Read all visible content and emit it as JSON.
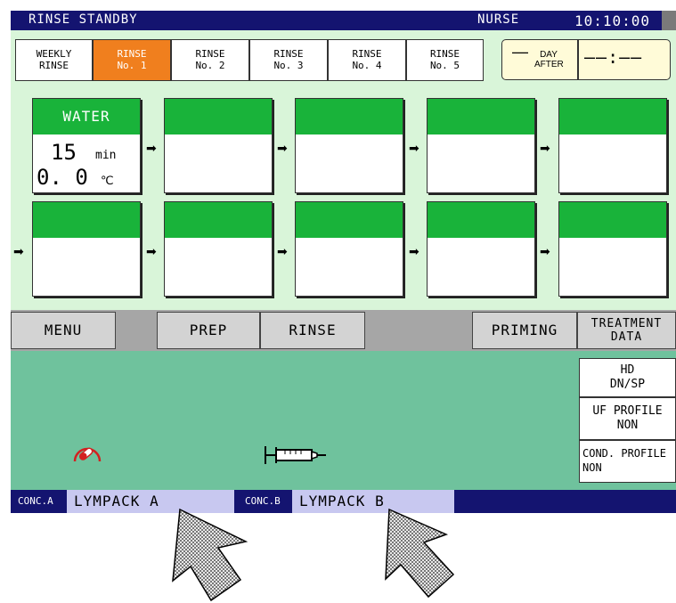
{
  "header": {
    "status": "RINSE STANDBY",
    "role": "NURSE",
    "time": "10:10:00"
  },
  "program_tabs": [
    {
      "line1": "WEEKLY",
      "line2": "RINSE"
    },
    {
      "line1": "RINSE",
      "line2": "No. 1"
    },
    {
      "line1": "RINSE",
      "line2": "No. 2"
    },
    {
      "line1": "RINSE",
      "line2": "No. 3"
    },
    {
      "line1": "RINSE",
      "line2": "No. 4"
    },
    {
      "line1": "RINSE",
      "line2": "No. 5"
    }
  ],
  "active_tab_index": 1,
  "day_after": {
    "dash": "—",
    "line1": "DAY",
    "line2": "AFTER",
    "time": "——:——"
  },
  "steps": {
    "first": {
      "title": "WATER",
      "minutes": "15",
      "min_unit": "min",
      "temp": "0. 0",
      "temp_unit": "℃"
    }
  },
  "menu": {
    "menu": "MENU",
    "prep": "PREP",
    "rinse": "RINSE",
    "priming": "PRIMING",
    "treatment_line1": "TREATMENT",
    "treatment_line2": "DATA"
  },
  "info": {
    "mode_line1": "HD",
    "mode_line2": "DN/SP",
    "uf_line1": "UF PROFILE",
    "uf_line2": "NON",
    "cond_line1": "COND. PROFILE",
    "cond_line2": "NON"
  },
  "conc": {
    "a_label": "CONC.A",
    "a_value": "LYMPACK A",
    "b_label": "CONC.B",
    "b_value": "LYMPACK B"
  },
  "colors": {
    "header": "#141470",
    "active_tab": "#f07f1e",
    "step_head": "#19b33a",
    "panel": "#6fc29d",
    "band": "#d9f5d9"
  },
  "icons": [
    "gauge-icon",
    "syringe-icon",
    "pointer-arrow-icon"
  ]
}
